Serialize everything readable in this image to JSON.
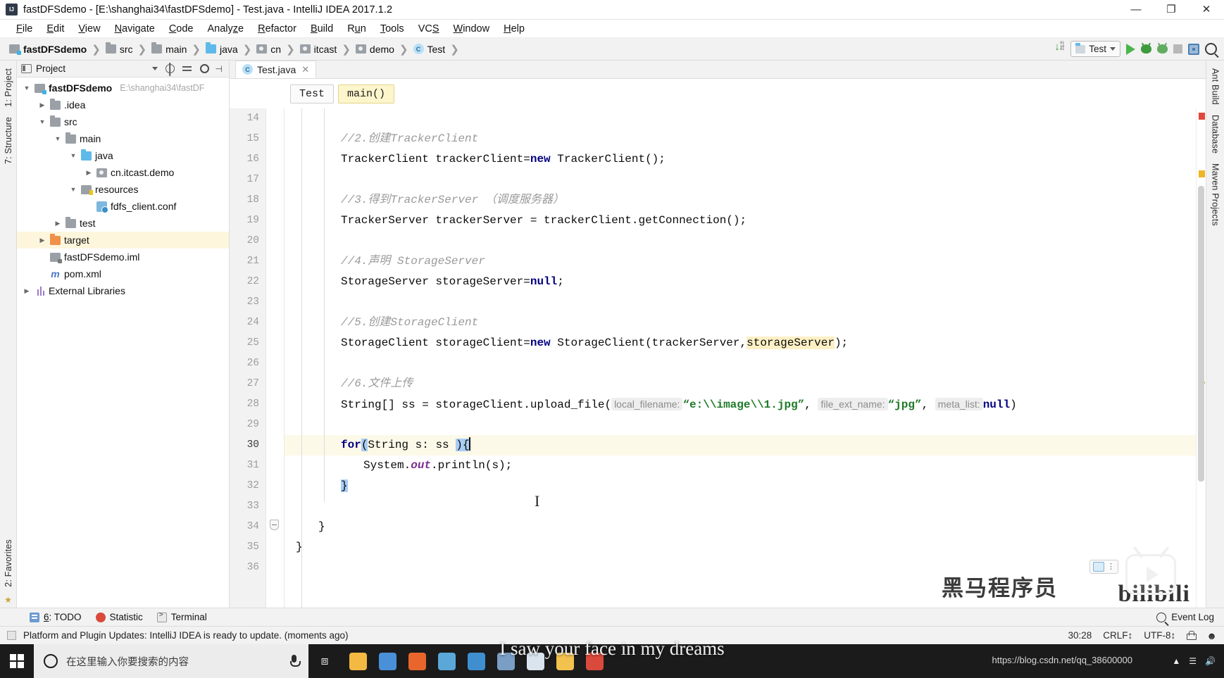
{
  "window": {
    "title": "fastDFSdemo - [E:\\shanghai34\\fastDFSdemo] - Test.java - IntelliJ IDEA 2017.1.2",
    "app_icon": "intellij-idea-icon",
    "minimize": "—",
    "maximize": "❐",
    "close": "✕"
  },
  "menu": {
    "items": [
      {
        "label": "File",
        "mnemonic": "F"
      },
      {
        "label": "Edit",
        "mnemonic": "E"
      },
      {
        "label": "View",
        "mnemonic": "V"
      },
      {
        "label": "Navigate",
        "mnemonic": "N"
      },
      {
        "label": "Code",
        "mnemonic": "C"
      },
      {
        "label": "Analyze",
        "mnemonic": "z"
      },
      {
        "label": "Refactor",
        "mnemonic": "R"
      },
      {
        "label": "Build",
        "mnemonic": "B"
      },
      {
        "label": "Run",
        "mnemonic": "u"
      },
      {
        "label": "Tools",
        "mnemonic": "T"
      },
      {
        "label": "VCS",
        "mnemonic": "S"
      },
      {
        "label": "Window",
        "mnemonic": "W"
      },
      {
        "label": "Help",
        "mnemonic": "H"
      }
    ]
  },
  "navbar": {
    "crumbs": [
      {
        "label": "fastDFSdemo",
        "icon": "module-icon",
        "bold": true
      },
      {
        "label": "src",
        "icon": "folder-icon"
      },
      {
        "label": "main",
        "icon": "folder-icon"
      },
      {
        "label": "java",
        "icon": "source-folder-icon"
      },
      {
        "label": "cn",
        "icon": "package-icon"
      },
      {
        "label": "itcast",
        "icon": "package-icon"
      },
      {
        "label": "demo",
        "icon": "package-icon"
      },
      {
        "label": "Test",
        "icon": "class-icon"
      }
    ],
    "separator": "❯",
    "run_config": "Test",
    "buttons": [
      {
        "name": "compile-icon",
        "label": ""
      },
      {
        "name": "run-button",
        "label": ""
      },
      {
        "name": "debug-button",
        "label": ""
      },
      {
        "name": "run-coverage-button",
        "label": ""
      },
      {
        "name": "stop-button",
        "label": ""
      },
      {
        "name": "database-grid-icon",
        "label": ""
      },
      {
        "name": "search-everywhere-icon",
        "label": ""
      }
    ]
  },
  "left_strip": {
    "tabs": [
      "1: Project",
      "7: Structure"
    ],
    "bottom_tabs": [
      "2: Favorites"
    ],
    "star": "★"
  },
  "right_strip": {
    "tabs": [
      "Ant Build",
      "Database",
      "Maven Projects"
    ]
  },
  "project_panel": {
    "title": "Project",
    "header_icons": [
      "project-view-icon",
      "chevron-down-icon",
      "locate-icon",
      "collapse-all-icon",
      "settings-gear-icon",
      "hide-icon"
    ],
    "tree": [
      {
        "label": "fastDFSdemo",
        "path": "E:\\shanghai34\\fastDF",
        "indent": 0,
        "arrow": "open",
        "icon": "module-icon",
        "bold": true,
        "highlight": false
      },
      {
        "label": ".idea",
        "path": "",
        "indent": 1,
        "arrow": "closed",
        "icon": "folder-icon",
        "bold": false,
        "highlight": false
      },
      {
        "label": "src",
        "path": "",
        "indent": 1,
        "arrow": "open",
        "icon": "folder-icon",
        "bold": false,
        "highlight": false
      },
      {
        "label": "main",
        "path": "",
        "indent": 2,
        "arrow": "open",
        "icon": "folder-icon",
        "bold": false,
        "highlight": false
      },
      {
        "label": "java",
        "path": "",
        "indent": 3,
        "arrow": "open",
        "icon": "source-folder-icon",
        "bold": false,
        "highlight": false
      },
      {
        "label": "cn.itcast.demo",
        "path": "",
        "indent": 4,
        "arrow": "closed",
        "icon": "package-icon",
        "bold": false,
        "highlight": false
      },
      {
        "label": "resources",
        "path": "",
        "indent": 3,
        "arrow": "open",
        "icon": "resources-folder-icon",
        "bold": false,
        "highlight": false
      },
      {
        "label": "fdfs_client.conf",
        "path": "",
        "indent": 4,
        "arrow": "none",
        "icon": "config-file-icon",
        "bold": false,
        "highlight": false
      },
      {
        "label": "test",
        "path": "",
        "indent": 2,
        "arrow": "closed",
        "icon": "folder-icon",
        "bold": false,
        "highlight": false
      },
      {
        "label": "target",
        "path": "",
        "indent": 1,
        "arrow": "closed",
        "icon": "excluded-folder-icon",
        "bold": false,
        "highlight": true
      },
      {
        "label": "fastDFSdemo.iml",
        "path": "",
        "indent": 1,
        "arrow": "none",
        "icon": "iml-file-icon",
        "bold": false,
        "highlight": false
      },
      {
        "label": "pom.xml",
        "path": "",
        "indent": 1,
        "arrow": "none",
        "icon": "maven-file-icon",
        "bold": false,
        "highlight": false
      },
      {
        "label": "External Libraries",
        "path": "",
        "indent": 0,
        "arrow": "closed",
        "icon": "libraries-icon",
        "bold": false,
        "highlight": false
      }
    ]
  },
  "editor": {
    "tab": {
      "label": "Test.java",
      "icon": "class-icon",
      "close": "✕"
    },
    "structure_chips": [
      {
        "label": "Test",
        "active": false
      },
      {
        "label": "main()",
        "active": true
      }
    ],
    "first_line": 14,
    "lines": [
      {
        "num": 14,
        "blank": true,
        "cut": true
      },
      {
        "num": 15,
        "tokens": [
          {
            "t": "cmt",
            "v": "//2.创建TrackerClient"
          }
        ],
        "indent": 2
      },
      {
        "num": 16,
        "tokens": [
          {
            "t": "txt",
            "v": "TrackerClient trackerClient="
          },
          {
            "t": "kw",
            "v": "new"
          },
          {
            "t": "txt",
            "v": " TrackerClient();"
          }
        ],
        "indent": 2
      },
      {
        "num": 17,
        "tokens": [],
        "indent": 2
      },
      {
        "num": 18,
        "tokens": [
          {
            "t": "cmt",
            "v": "//3.得到TrackerServer （调度服务器）"
          }
        ],
        "indent": 2
      },
      {
        "num": 19,
        "tokens": [
          {
            "t": "txt",
            "v": "TrackerServer trackerServer = trackerClient.getConnection();"
          }
        ],
        "indent": 2
      },
      {
        "num": 20,
        "tokens": [],
        "indent": 2
      },
      {
        "num": 21,
        "tokens": [
          {
            "t": "cmt",
            "v": "//4.声明 StorageServer"
          }
        ],
        "indent": 2
      },
      {
        "num": 22,
        "tokens": [
          {
            "t": "txt",
            "v": "StorageServer storageServer="
          },
          {
            "t": "kw",
            "v": "null"
          },
          {
            "t": "txt",
            "v": ";"
          }
        ],
        "indent": 2
      },
      {
        "num": 23,
        "tokens": [],
        "indent": 2
      },
      {
        "num": 24,
        "tokens": [
          {
            "t": "cmt",
            "v": "//5.创建StorageClient"
          }
        ],
        "indent": 2
      },
      {
        "num": 25,
        "tokens": [
          {
            "t": "txt",
            "v": "StorageClient storageClient="
          },
          {
            "t": "kw",
            "v": "new"
          },
          {
            "t": "txt",
            "v": " StorageClient(trackerServer,"
          },
          {
            "t": "selhl",
            "v": "storageServer"
          },
          {
            "t": "txt",
            "v": ");"
          }
        ],
        "indent": 2
      },
      {
        "num": 26,
        "tokens": [],
        "indent": 2
      },
      {
        "num": 27,
        "tokens": [
          {
            "t": "cmt",
            "v": "//6.文件上传"
          }
        ],
        "indent": 2
      },
      {
        "num": 28,
        "tokens": [
          {
            "t": "txt",
            "v": "String[] ss = storageClient.upload_file("
          },
          {
            "t": "hint",
            "v": "local_filename:"
          },
          {
            "t": "str",
            "v": "“e:\\\\image\\\\1.jpg”"
          },
          {
            "t": "txt",
            "v": ", "
          },
          {
            "t": "hint",
            "v": "file_ext_name:"
          },
          {
            "t": "str",
            "v": "“jpg”"
          },
          {
            "t": "txt",
            "v": ", "
          },
          {
            "t": "hint",
            "v": "meta_list:"
          },
          {
            "t": "kw",
            "v": "null"
          },
          {
            "t": "txt",
            "v": ")"
          }
        ],
        "indent": 2
      },
      {
        "num": 29,
        "tokens": [],
        "indent": 2
      },
      {
        "num": 30,
        "tokens": [
          {
            "t": "kw",
            "v": "for"
          },
          {
            "t": "brmatch",
            "v": "("
          },
          {
            "t": "txt",
            "v": "String s: ss "
          },
          {
            "t": "brmatch",
            "v": ")"
          },
          {
            "t": "brmatch",
            "v": "{"
          },
          {
            "t": "caret",
            "v": ""
          }
        ],
        "indent": 2,
        "current": true
      },
      {
        "num": 31,
        "tokens": [
          {
            "t": "txt",
            "v": "System."
          },
          {
            "t": "fld",
            "v": "out"
          },
          {
            "t": "txt",
            "v": ".println(s);"
          }
        ],
        "indent": 3
      },
      {
        "num": 32,
        "tokens": [
          {
            "t": "brmatch",
            "v": "}"
          }
        ],
        "indent": 2
      },
      {
        "num": 33,
        "tokens": [],
        "indent": 2
      },
      {
        "num": 34,
        "tokens": [
          {
            "t": "txt",
            "v": "}"
          }
        ],
        "indent": 1,
        "fold": true
      },
      {
        "num": 35,
        "tokens": [
          {
            "t": "txt",
            "v": "}"
          }
        ],
        "indent": 0
      },
      {
        "num": 36,
        "tokens": [],
        "indent": 0,
        "cut": true
      }
    ]
  },
  "tool_windows": {
    "items": [
      {
        "label": "6: TODO",
        "mnemonic": "6",
        "icon": "todo-icon"
      },
      {
        "label": "Statistic",
        "mnemonic": "",
        "icon": "statistic-icon"
      },
      {
        "label": "Terminal",
        "mnemonic": "",
        "icon": "terminal-icon"
      }
    ],
    "event_log": "Event Log",
    "event_log_icon": "event-log-icon"
  },
  "status_bar": {
    "message": "Platform and Plugin Updates: IntelliJ IDEA is ready to update. (moments ago)",
    "caret_position": "30:28",
    "line_separator": "CRLF↕",
    "encoding": "UTF-8↕",
    "indicators": [
      "lock-icon",
      "hector-icon"
    ]
  },
  "taskbar": {
    "start_icon": "windows-start-icon",
    "search_placeholder": "在这里输入你要搜索的内容",
    "mic_icon": "microphone-icon",
    "task_view_icon": "task-view-icon",
    "pinned": [
      {
        "name": "file-explorer-icon",
        "color": "#f4b942"
      },
      {
        "name": "chrome-icon",
        "color": "#4a90d9"
      },
      {
        "name": "firefox-icon",
        "color": "#e8662b"
      },
      {
        "name": "intellij-icon",
        "color": "#5aa7d8"
      },
      {
        "name": "editplus-icon",
        "color": "#3f8fd0"
      },
      {
        "name": "media-player-icon",
        "color": "#7a9ec4"
      },
      {
        "name": "notepad-icon",
        "color": "#d9e4ee"
      },
      {
        "name": "folder-icon",
        "color": "#f2c14e"
      },
      {
        "name": "pdf-icon",
        "color": "#d94a3d"
      }
    ],
    "tray_time": ""
  },
  "overlays": {
    "heima": "黑马程序员",
    "bilibili": "bilibili",
    "url": "https://blog.csdn.net/qq_38600000",
    "subtitle": "I saw your face in my dreams"
  },
  "colors": {
    "accent_blue": "#4a7fb5",
    "run_green": "#49b54a",
    "keyword_blue": "#000082",
    "string_green": "#1d7a27",
    "comment_gray": "#9a9a9a",
    "field_purple": "#7a2d8f",
    "highlight_yellow": "#fdf6dd",
    "excluded_orange": "#f0914a"
  }
}
